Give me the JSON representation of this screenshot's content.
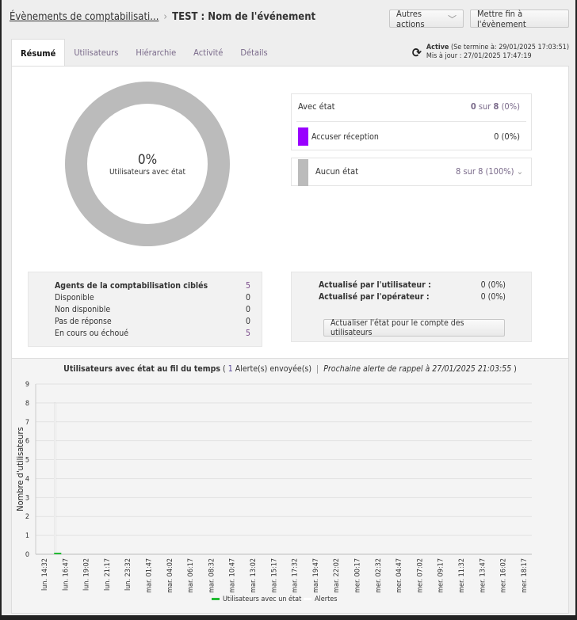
{
  "breadcrumb": {
    "parent": "Évènements de comptabilisati...",
    "current": "TEST : Nom de l'événement"
  },
  "actions": {
    "more": "Autres actions",
    "end": "Mettre fin à l'évènement"
  },
  "tabs": [
    {
      "label": "Résumé",
      "active": true
    },
    {
      "label": "Utilisateurs"
    },
    {
      "label": "Hiérarchie"
    },
    {
      "label": "Activité"
    },
    {
      "label": "Détails"
    }
  ],
  "status": {
    "state": "Active",
    "ends": "(Se termine à: 29/01/2025 17:03:51)",
    "updated": "Mis à jour : 27/01/2025 17:47:19",
    "icon": "refresh-icon"
  },
  "donut": {
    "percent": "0%",
    "label": "Utilisateurs avec état",
    "fill_fraction": 0,
    "color": "#bbbbbb"
  },
  "with_state": {
    "label": "Avec état",
    "count": "0",
    "sur": "sur",
    "total": "8",
    "pct": "(0%)"
  },
  "ack": {
    "label": "Accuser réception",
    "value": "0 (0%)",
    "color": "#9900ff"
  },
  "no_state": {
    "label": "Aucun état",
    "value": "8 sur 8 (100%)",
    "color": "#bbbbbb"
  },
  "agents": {
    "rows": [
      {
        "label": "Agents de la comptabilisation ciblés",
        "value": "5"
      },
      {
        "label": "Disponible",
        "value": "0"
      },
      {
        "label": "Non disponible",
        "value": "0"
      },
      {
        "label": "Pas de réponse",
        "value": "0"
      },
      {
        "label": "En cours ou échoué",
        "value": "5"
      }
    ]
  },
  "updates": {
    "user_label": "Actualisé par l'utilisateur :",
    "user_value": "0 (0%)",
    "op_label": "Actualisé par l'opérateur :",
    "op_value": "0 (0%)",
    "button": "Actualiser l'état pour le compte des utilisateurs"
  },
  "chart_header": {
    "title": "Utilisateurs avec état au fil du temps",
    "open": "(",
    "alerts_count": "1",
    "alerts_text": "Alerte(s) envoyée(s)",
    "sep": "|",
    "next": "Prochaine alerte de rappel à 27/01/2025 21:03:55",
    "close": ")"
  },
  "chart_data": {
    "type": "bar",
    "ylabel": "Nombre d'utilisateurs",
    "ylim": [
      0,
      9
    ],
    "yticks": [
      0,
      1,
      2,
      3,
      4,
      5,
      6,
      7,
      8,
      9
    ],
    "grid": true,
    "legend": "bottom",
    "categories": [
      "lun. 14:32",
      "lun. 16:47",
      "lun. 19:02",
      "lun. 21:17",
      "lun. 23:32",
      "mar. 01:47",
      "mar. 04:02",
      "mar. 06:17",
      "mar. 08:32",
      "mar. 10:47",
      "mar. 13:02",
      "mar. 15:17",
      "mar. 17:32",
      "mar. 19:47",
      "mar. 22:02",
      "mer. 00:17",
      "mer. 02:32",
      "mer. 04:47",
      "mer. 07:02",
      "mer. 09:17",
      "mer. 11:32",
      "mer. 13:47",
      "mer. 16:02",
      "mer. 18:17"
    ],
    "series": [
      {
        "name": "Utilisateurs avec un état",
        "color": "#22bb33",
        "values": [
          0,
          0,
          null,
          null,
          null,
          null,
          null,
          null,
          null,
          null,
          null,
          null,
          null,
          null,
          null,
          null,
          null,
          null,
          null,
          null,
          null,
          null,
          null,
          null
        ]
      },
      {
        "name": "Alertes",
        "color": "#ffffff",
        "values": [
          null,
          8,
          null,
          null,
          null,
          null,
          null,
          null,
          null,
          null,
          null,
          null,
          null,
          null,
          null,
          null,
          null,
          null,
          null,
          null,
          null,
          null,
          null,
          null
        ]
      }
    ]
  }
}
